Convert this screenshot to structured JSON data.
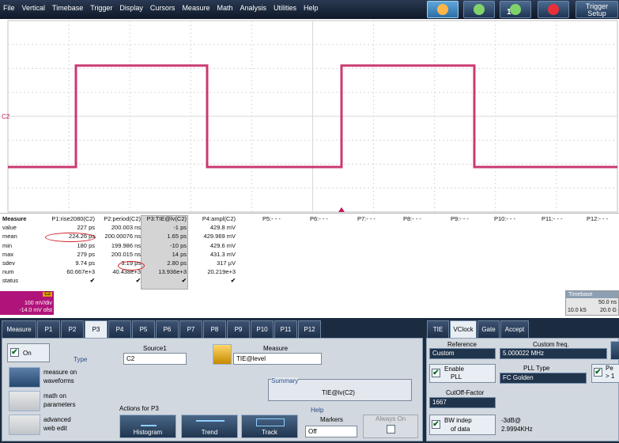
{
  "menu": [
    "File",
    "Vertical",
    "Timebase",
    "Trigger",
    "Display",
    "Cursors",
    "Measure",
    "Math",
    "Analysis",
    "Utilities",
    "Help"
  ],
  "toolbar": {
    "trigger_setup_line1": "Trigger",
    "trigger_setup_line2": "Setup",
    "count_badge": "1"
  },
  "channel": {
    "marker": "C2",
    "trigger_marker": "T",
    "color": "#c2185b"
  },
  "measure": {
    "header_label": "Measure",
    "row_labels": [
      "value",
      "mean",
      "min",
      "max",
      "sdev",
      "num",
      "status"
    ],
    "columns": [
      {
        "name": "P1:rise2080(C2)",
        "values": [
          "227 ps",
          "224.26 ps",
          "180 ps",
          "279 ps",
          "9.74 ps",
          "60.667e+3",
          "✔"
        ]
      },
      {
        "name": "P2:period(C2)",
        "values": [
          "200.003 ns",
          "200.00076 ns",
          "199.986 ns",
          "200.015 ns",
          "3.19 ps",
          "40.438e+3",
          "✔"
        ]
      },
      {
        "name": "P3:TIE@lv(C2)",
        "values": [
          "-1 ps",
          "1.65 ps",
          "-10 ps",
          "14 ps",
          "2.80 ps",
          "13.936e+3",
          "✔"
        ]
      },
      {
        "name": "P4:ampl(C2)",
        "values": [
          "429.8 mV",
          "429.969 mV",
          "429.6 mV",
          "431.3 mV",
          "317 µV",
          "20.219e+3",
          "✔"
        ]
      }
    ],
    "empty_columns": [
      "P5:- - -",
      "P6:- - -",
      "P7:- - -",
      "P8:- - -",
      "P9:- - -",
      "P10:- - -",
      "P11:- - -",
      "P12:- - -"
    ]
  },
  "c2_label": {
    "name": "C2",
    "scale": "100 mV/div",
    "offset": "-14.0 mV ofst"
  },
  "timebase": {
    "title": "Timebase",
    "rate": "50.0 ns",
    "samples": "10.0 kS",
    "rate2": "20.0 G"
  },
  "tabs_left": [
    "Measure",
    "P1",
    "P2",
    "P3",
    "P4",
    "P5",
    "P6",
    "P7",
    "P8",
    "P9",
    "P10",
    "P11",
    "P12"
  ],
  "selected_tab": "P3",
  "p3": {
    "on_label": "On",
    "type_label": "Type",
    "type_options": [
      {
        "label1": "measure on",
        "label2": "waveforms",
        "icon": "waveform-measure-icon"
      },
      {
        "label1": "math on",
        "label2": "parameters",
        "icon": "math-params-icon"
      },
      {
        "label1": "advanced",
        "label2": "web edit",
        "icon": "web-edit-icon"
      }
    ],
    "source_label": "Source1",
    "source_value": "C2",
    "measure_label": "Measure",
    "measure_value": "TIE@level",
    "summary_label": "Summary",
    "summary_value": "TIE@lv(C2)",
    "actions_label": "Actions for P3",
    "actions": [
      "Histogram",
      "Trend",
      "Track"
    ],
    "help_label": "Help",
    "markers_label": "Markers",
    "markers_value": "Off",
    "always_on_label": "Always On"
  },
  "tabs_right": [
    "TIE",
    "VClock",
    "Gate",
    "Accept"
  ],
  "selected_right_tab": "VClock",
  "vclock": {
    "reference_label": "Reference",
    "reference_value": "Custom",
    "custom_freq_label": "Custom freq.",
    "custom_freq_value": "5.000022 MHz",
    "enable_pll_line1": "Enable",
    "enable_pll_line2": "PLL",
    "pll_type_label": "PLL Type",
    "pll_type_value": "FC Golden",
    "per_label_1": "Pe",
    "per_label_2": "> 1",
    "cutoff_label": "CutOff-Factor",
    "cutoff_value": "1667",
    "bw_line1": "BW indep",
    "bw_line2": "of data",
    "bw_val1": "-3dB@",
    "bw_val2": "2.9994KHz"
  }
}
